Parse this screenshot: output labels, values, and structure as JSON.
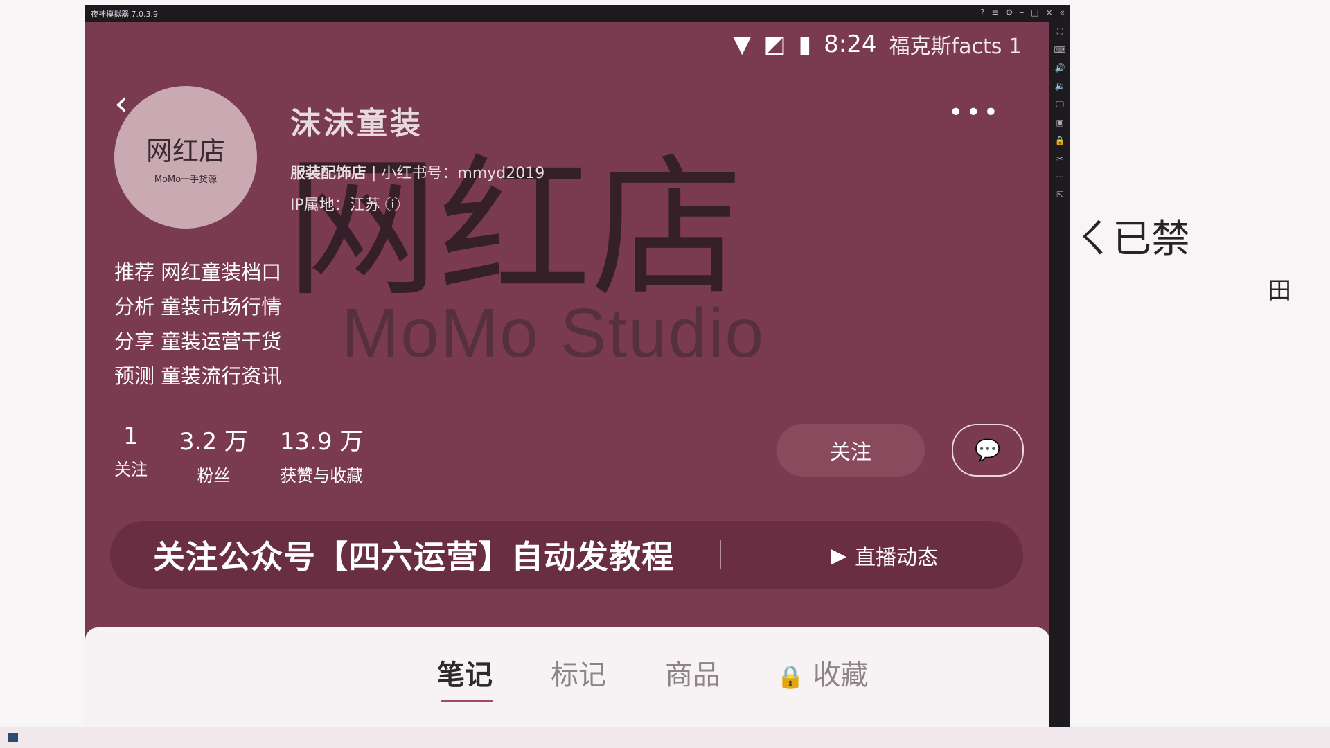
{
  "whiteboard": {
    "strokes": [
      "ㄑ已禁",
      "田"
    ]
  },
  "emulator": {
    "title": "夜神模拟器 7.0.3.9",
    "window_controls": [
      "?",
      "≡",
      "⚙",
      "–",
      "□",
      "×",
      "«"
    ]
  },
  "status": {
    "time": "8:24",
    "overlay_text": "福克斯facts 1"
  },
  "background": {
    "big_text": "网红店",
    "studio_text": "MoMo Studio"
  },
  "profile": {
    "avatar_text": "网红店",
    "avatar_sub": "MoMo一手货源",
    "name": "沫沫童装",
    "category": "服装配饰店",
    "id": "小红书号：mmyd2019",
    "ip": "IP属地：江苏",
    "bio": [
      "推荐 网红童装档口",
      "分析 童装市场行情",
      "分享 童装运营干货",
      "预测 童装流行资讯"
    ]
  },
  "stats": [
    {
      "value": "1",
      "label": "关注"
    },
    {
      "value": "3.2 万",
      "label": "粉丝"
    },
    {
      "value": "13.9 万",
      "label": "获赞与收藏"
    }
  ],
  "actions": {
    "follow_label": "关注",
    "more": "•••"
  },
  "banner": {
    "promo": "关注公众号【四六运营】自动发教程",
    "live_label": "直播动态"
  },
  "tabs": [
    {
      "label": "笔记"
    },
    {
      "label": "标记"
    },
    {
      "label": "商品"
    },
    {
      "label": "收藏"
    }
  ],
  "colors": {
    "accent": "#7a3a4f",
    "tab_active": "#a44a60"
  }
}
